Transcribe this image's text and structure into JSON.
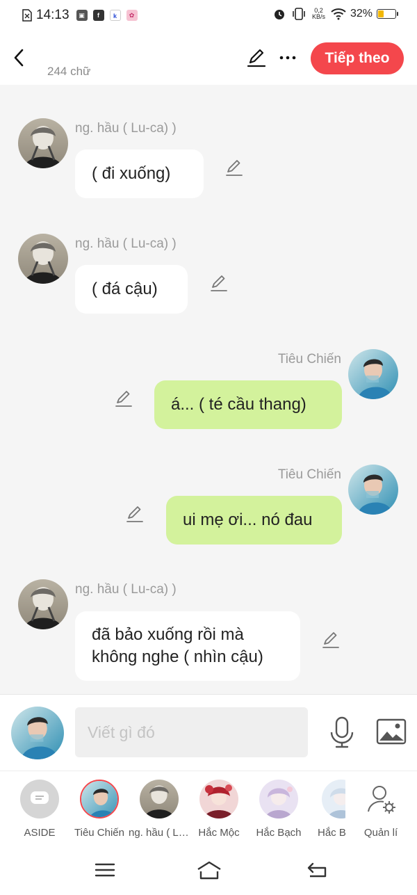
{
  "status_bar": {
    "time": "14:13",
    "network_speed_value": "0,2",
    "network_speed_unit": "KB/s",
    "battery_percent": "32%",
    "battery_level": 0.32
  },
  "top_bar": {
    "word_count": "244 chữ",
    "next_label": "Tiếp theo",
    "accent_color": "#f4474c"
  },
  "messages": [
    {
      "side": "left",
      "sender": "ng. hầu ( Lu-ca) )",
      "lines": [
        "( đi xuống)"
      ]
    },
    {
      "side": "left",
      "sender": "ng. hầu ( Lu-ca) )",
      "lines": [
        "( đá cậu)"
      ]
    },
    {
      "side": "right",
      "sender": "Tiêu Chiến",
      "lines": [
        "á... ( té cầu thang)"
      ]
    },
    {
      "side": "right",
      "sender": "Tiêu Chiến",
      "lines": [
        "ui mẹ ơi... nó đau"
      ]
    },
    {
      "side": "left",
      "sender": "ng. hầu ( Lu-ca) )",
      "lines": [
        "đã bảo xuống rồi mà",
        "không nghe ( nhìn cậu)"
      ]
    }
  ],
  "input": {
    "placeholder": "Viết gì đó"
  },
  "characters": [
    {
      "label": "ASIDE",
      "icon": "aside-icon"
    },
    {
      "label": "Tiêu Chiến",
      "icon": "avatar-tieu-chien",
      "selected": true
    },
    {
      "label": "ng. hầu ( Lu-ca) )",
      "icon": "avatar-luca"
    },
    {
      "label": "Hắc Mộc",
      "icon": "avatar-hac-moc"
    },
    {
      "label": "Hắc Bạch",
      "icon": "avatar-hac-bach"
    },
    {
      "label": "Hắc B",
      "icon": "avatar-hac-b"
    },
    {
      "label": "Quản lí",
      "icon": "manage-user-icon"
    }
  ],
  "colors": {
    "green_bubble": "#d3f29c",
    "white_bubble": "#ffffff",
    "background": "#f5f5f5"
  }
}
